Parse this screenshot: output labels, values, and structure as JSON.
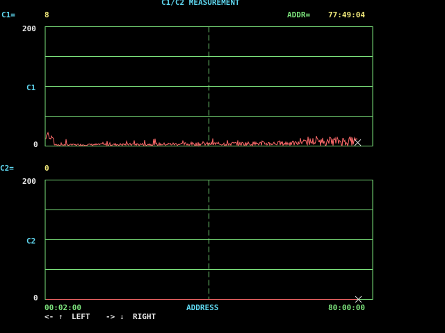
{
  "header": {
    "title": "C1/C2 MEASUREMENT"
  },
  "readouts": {
    "c1_label": "C1=",
    "c1_value": "8",
    "addr_label": "ADDR=",
    "addr_value": "77:49:04",
    "c2_label": "C2=",
    "c2_value": "0"
  },
  "plot1": {
    "y_max": "200",
    "y_mid": "C1",
    "y_min": "0"
  },
  "plot2": {
    "y_max": "200",
    "y_mid": "C2",
    "y_min": "0"
  },
  "x_axis": {
    "start": "00:02:00",
    "label": "ADDRESS",
    "end": "80:00:00"
  },
  "nav": {
    "left_keys": "<-",
    "left_label": "LEFT",
    "right_keys": "->",
    "right_label": "RIGHT"
  },
  "colors": {
    "grid": "#7ce37c",
    "trace": "#ff6b6b",
    "text_cyan": "#5fd7f0",
    "text_yellow": "#f0e87a"
  }
}
